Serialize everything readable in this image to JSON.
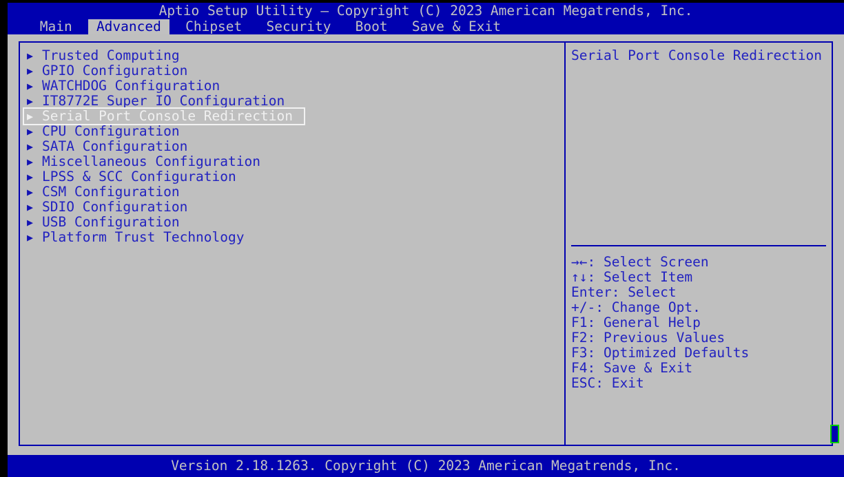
{
  "colors": {
    "screen_blue": "#0000b0",
    "panel_gray": "#bfbfbf",
    "text_blue": "#2222c0",
    "text_light": "#c2c2c2",
    "selected_text": "#f0f0f0",
    "scroll_green": "#00d000"
  },
  "header": {
    "title": "Aptio Setup Utility – Copyright (C) 2023 American Megatrends, Inc."
  },
  "menu": {
    "tabs": [
      {
        "label": "Main",
        "selected": false
      },
      {
        "label": "Advanced",
        "selected": true
      },
      {
        "label": "Chipset",
        "selected": false
      },
      {
        "label": "Security",
        "selected": false
      },
      {
        "label": "Boot",
        "selected": false
      },
      {
        "label": "Save & Exit",
        "selected": false
      }
    ]
  },
  "main": {
    "bullet_glyph": "▶",
    "items": [
      {
        "label": "Trusted Computing",
        "selected": false
      },
      {
        "label": "GPIO Configuration",
        "selected": false
      },
      {
        "label": "WATCHDOG Configuration",
        "selected": false
      },
      {
        "label": "IT8772E Super IO Configuration",
        "selected": false
      },
      {
        "label": "Serial Port Console Redirection",
        "selected": true
      },
      {
        "label": "CPU Configuration",
        "selected": false
      },
      {
        "label": "SATA Configuration",
        "selected": false
      },
      {
        "label": "Miscellaneous Configuration",
        "selected": false
      },
      {
        "label": "LPSS & SCC Configuration",
        "selected": false
      },
      {
        "label": "CSM Configuration",
        "selected": false
      },
      {
        "label": "SDIO Configuration",
        "selected": false
      },
      {
        "label": "USB Configuration",
        "selected": false
      },
      {
        "label": "Platform Trust Technology",
        "selected": false
      }
    ]
  },
  "help": {
    "title": "Serial Port Console Redirection",
    "legend": [
      {
        "key": "→←",
        "separator": ": ",
        "action": "Select Screen"
      },
      {
        "key": "↑↓",
        "separator": ": ",
        "action": "Select Item"
      },
      {
        "key": "Enter",
        "separator": ": ",
        "action": "Select"
      },
      {
        "key": "+/-",
        "separator": ": ",
        "action": "Change Opt."
      },
      {
        "key": "F1",
        "separator": ": ",
        "action": "General Help"
      },
      {
        "key": "F2",
        "separator": ": ",
        "action": "Previous Values"
      },
      {
        "key": "F3",
        "separator": ": ",
        "action": "Optimized Defaults"
      },
      {
        "key": "F4",
        "separator": ": ",
        "action": "Save & Exit"
      },
      {
        "key": "ESC",
        "separator": ": ",
        "action": "Exit"
      }
    ]
  },
  "footer": {
    "version": "Version 2.18.1263. Copyright (C) 2023 American Megatrends, Inc."
  }
}
